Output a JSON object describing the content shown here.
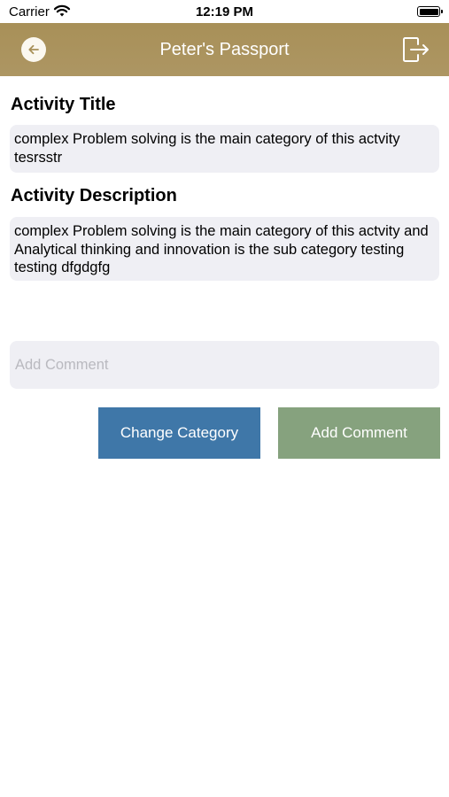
{
  "status_bar": {
    "carrier": "Carrier",
    "time": "12:19 PM"
  },
  "header": {
    "title": "Peter's Passport",
    "background_color": "#a89058",
    "back_icon": "arrow-left-icon",
    "logout_icon": "logout-icon"
  },
  "activity_title": {
    "label": "Activity Title",
    "value": "complex Problem solving is the main category of this actvity tesrsstr"
  },
  "activity_description": {
    "label": "Activity Description",
    "value": "complex Problem solving is the main category of this actvity and Analytical thinking and innovation is the sub category testing  testing dfgdgfg"
  },
  "comment": {
    "placeholder": "Add Comment",
    "value": ""
  },
  "actions": {
    "change_category_label": "Change Category",
    "change_category_color": "#3f77a8",
    "add_comment_label": "Add Comment",
    "add_comment_color": "#86a27e"
  }
}
